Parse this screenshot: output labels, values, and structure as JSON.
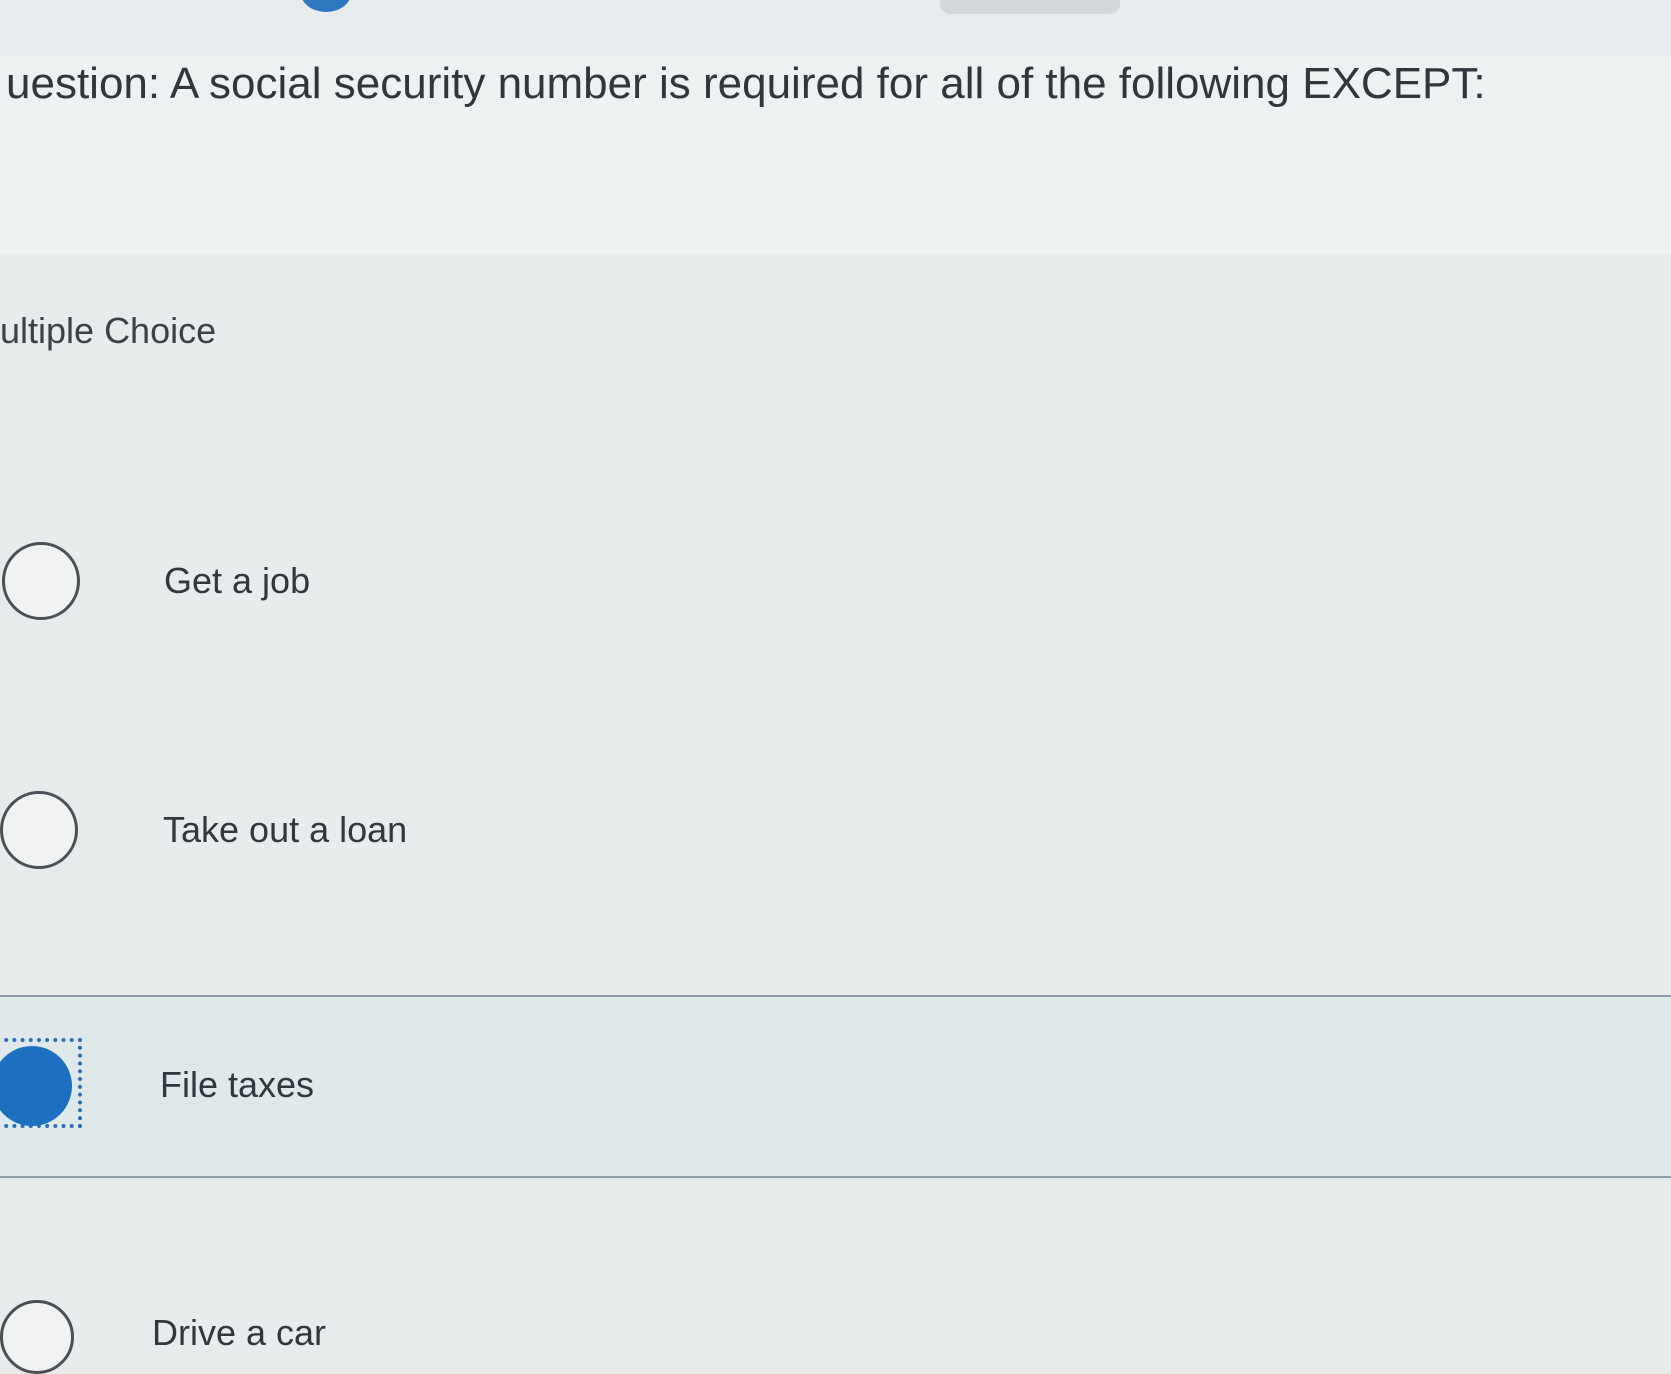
{
  "question": {
    "text": "uestion: A social security number is required for all of the following EXCEPT:"
  },
  "question_type": "ultiple Choice",
  "choices": [
    {
      "label": "Get a job",
      "selected": false
    },
    {
      "label": "Take out a loan",
      "selected": false
    },
    {
      "label": "File taxes",
      "selected": true
    },
    {
      "label": "Drive a car",
      "selected": false
    }
  ],
  "colors": {
    "selected_radio": "#1d6fc0",
    "focus_outline": "#2d6fb7",
    "text": "#30373d",
    "divider": "#8f9ea6"
  }
}
